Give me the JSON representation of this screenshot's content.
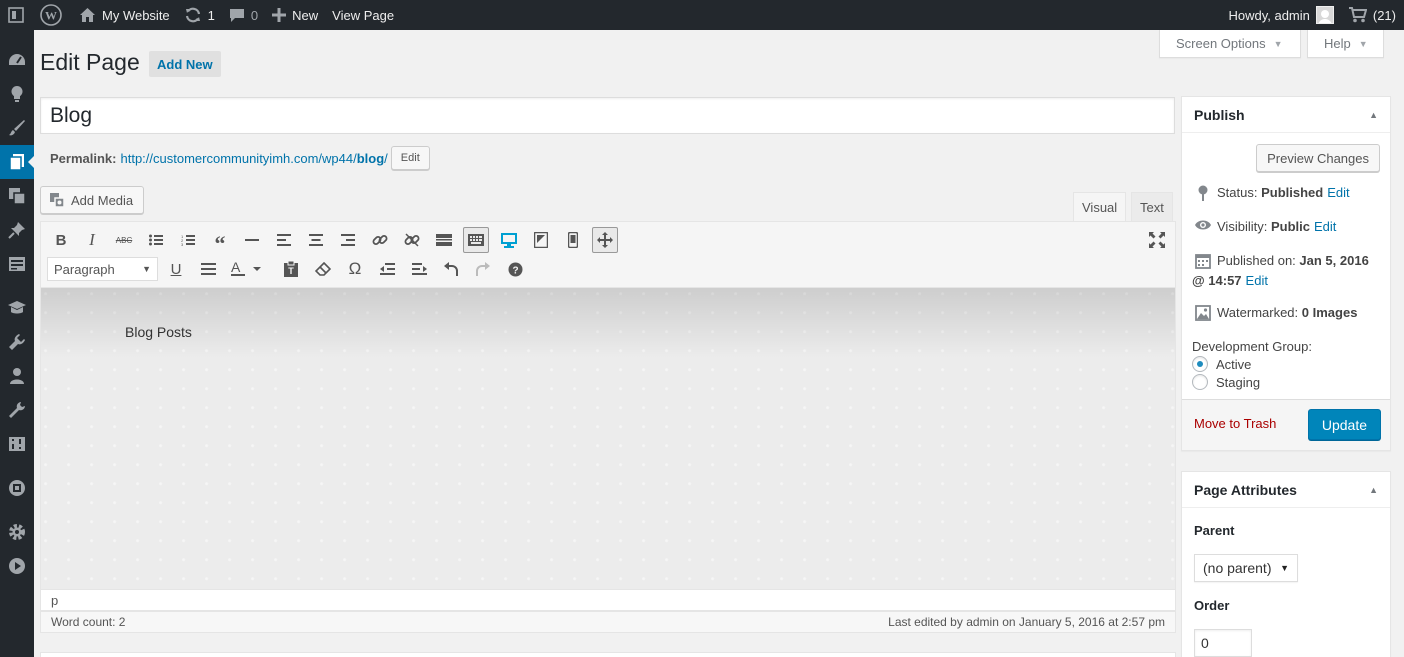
{
  "adminbar": {
    "site_name": "My Website",
    "updates_count": "1",
    "comments_count": "0",
    "new_label": "New",
    "view_label": "View Page",
    "howdy": "Howdy, admin",
    "cart_count": "(21)"
  },
  "screen_meta": {
    "screen_options": "Screen Options",
    "help": "Help"
  },
  "heading": {
    "title": "Edit Page",
    "add_new": "Add New"
  },
  "post": {
    "title": "Blog",
    "permalink_label": "Permalink:",
    "permalink_base": "http://customercommunityimh.com/wp44/",
    "permalink_slug": "blog",
    "permalink_trailing": "/",
    "permalink_edit": "Edit"
  },
  "editor": {
    "add_media": "Add Media",
    "tab_visual": "Visual",
    "tab_text": "Text",
    "format": "Paragraph",
    "content": "Blog Posts",
    "path": "p",
    "word_count": "Word count: 2",
    "last_edited": "Last edited by admin on January 5, 2016 at 2:57 pm"
  },
  "publish": {
    "title": "Publish",
    "preview": "Preview Changes",
    "status_label": "Status:",
    "status_value": "Published",
    "visibility_label": "Visibility:",
    "visibility_value": "Public",
    "published_label": "Published on:",
    "published_date": "Jan 5, 2016",
    "published_time": "@ 14:57",
    "edit": "Edit",
    "watermarked_label": "Watermarked:",
    "watermarked_value": "0 Images",
    "dev_group_label": "Development Group:",
    "dev_options": [
      "Active",
      "Staging"
    ],
    "dev_selected": "Active",
    "trash": "Move to Trash",
    "update": "Update"
  },
  "attributes": {
    "title": "Page Attributes",
    "parent_label": "Parent",
    "parent_value": "(no parent)",
    "order_label": "Order",
    "order_value": "0"
  },
  "colors": {
    "adminbar_bg": "#23282d",
    "accent": "#0073aa",
    "primary_button": "#0085ba",
    "trash_link": "#a00"
  }
}
